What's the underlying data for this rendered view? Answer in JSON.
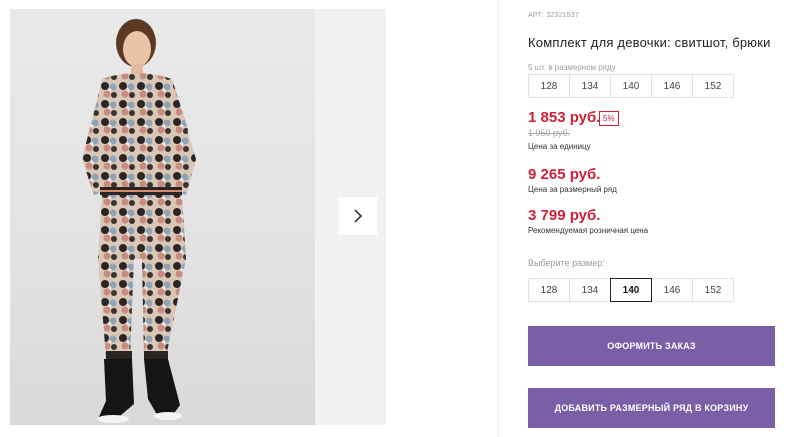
{
  "product": {
    "article": "АРТ: 32321537",
    "title": "Комплект для девочки: свитшот, брюки",
    "pack_note": "5 шт. в размерном ряду",
    "size_row": [
      "128",
      "134",
      "140",
      "146",
      "152"
    ]
  },
  "prices": {
    "unit_price": "1 853 руб.",
    "discount": "5%",
    "old_price": "1 950 руб.",
    "unit_caption": "Цена за единицу",
    "row_price": "9 265 руб.",
    "row_caption": "Цена за размерный ряд",
    "rrp_price": "3 799 руб.",
    "rrp_caption": "Рекомендуемая розничная цена"
  },
  "size_select": {
    "label": "Выберите размер:",
    "options": [
      "128",
      "134",
      "140",
      "146",
      "152"
    ],
    "selected": "140"
  },
  "actions": {
    "order": "ОФОРМИТЬ ЗАКАЗ",
    "add_row": "ДОБАВИТЬ РАЗМЕРНЫЙ РЯД В КОРЗИНУ"
  },
  "colors": {
    "price": "#d0203a",
    "button": "#7a5fa6"
  },
  "icons": {
    "next": "chevron-right-icon"
  }
}
